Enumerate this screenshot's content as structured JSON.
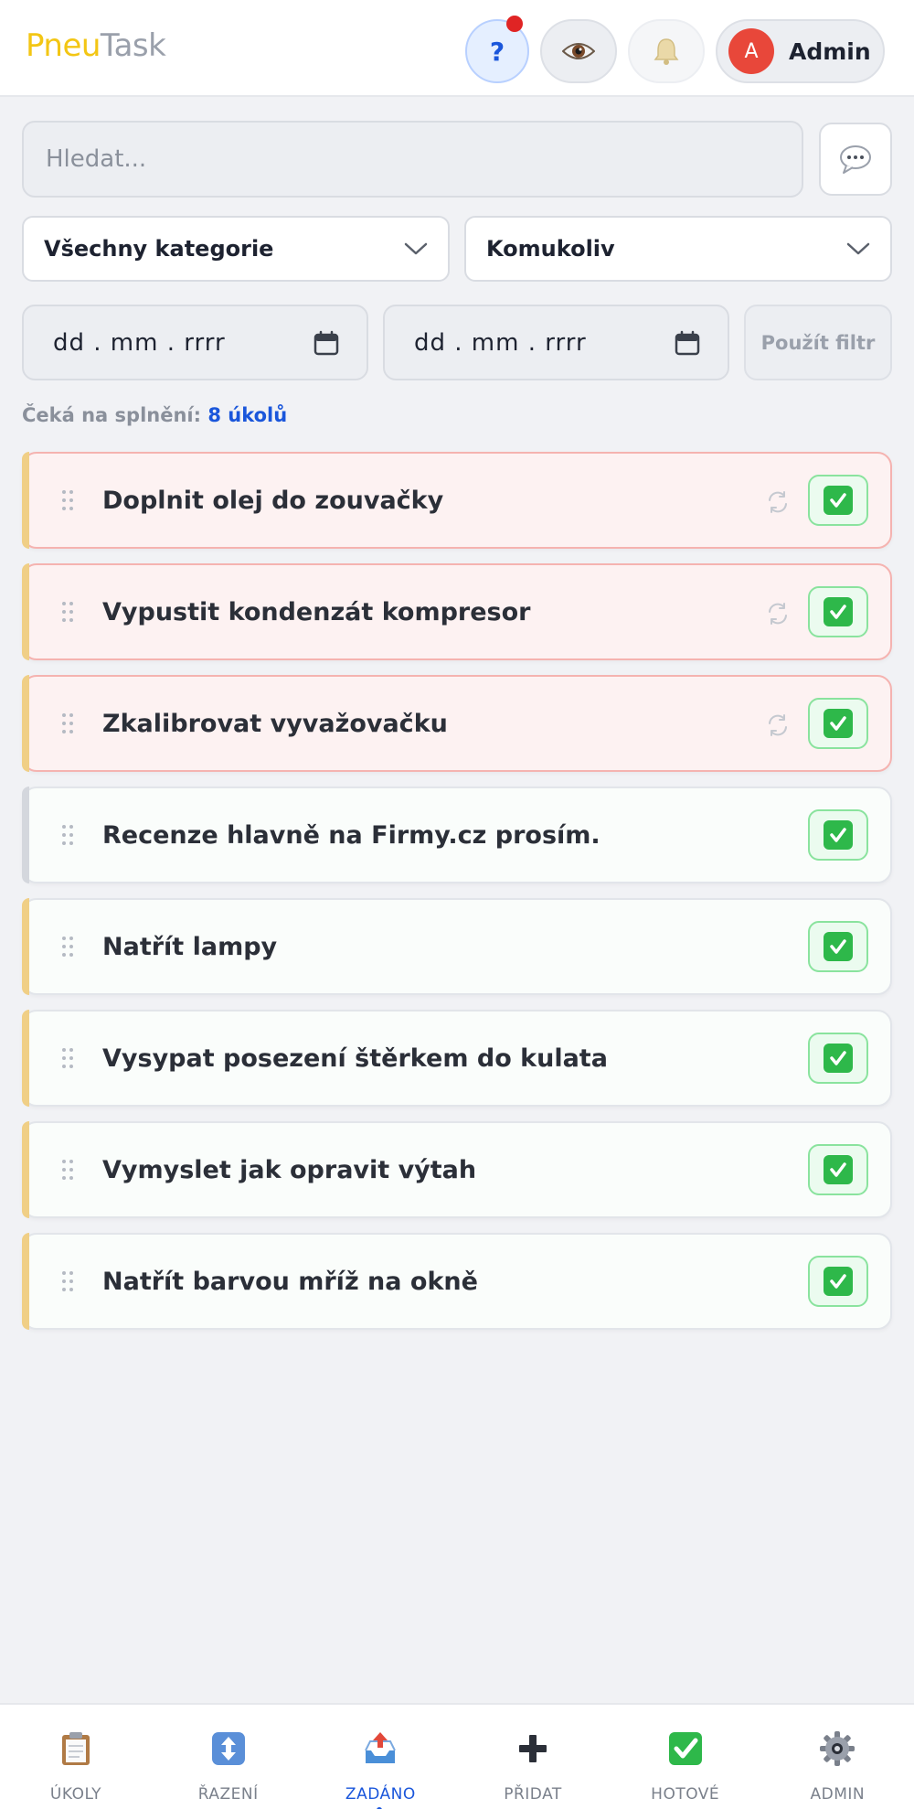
{
  "header": {
    "logo_part1": "Pneu",
    "logo_part2": "Task",
    "help_label": "?",
    "user": {
      "initial": "A",
      "name": "Admin"
    }
  },
  "search": {
    "placeholder": "Hledat..."
  },
  "filters": {
    "category": "Všechny kategorie",
    "assignee": "Komukoliv",
    "date_from_placeholder": "dd . mm . rrrr",
    "date_to_placeholder": "dd . mm . rrrr",
    "apply_label": "Použít filtr"
  },
  "counter": {
    "label": "Čeká na splnění:",
    "value": "8 úkolů"
  },
  "tasks": [
    {
      "title": "Doplnit olej do zouvačky",
      "overdue": true,
      "recurring": true,
      "accent": "#f0cf86"
    },
    {
      "title": "Vypustit kondenzát kompresor",
      "overdue": true,
      "recurring": true,
      "accent": "#f0cf86"
    },
    {
      "title": "Zkalibrovat vyvažovačku",
      "overdue": true,
      "recurring": true,
      "accent": "#f0cf86"
    },
    {
      "title": "Recenze hlavně na Firmy.cz prosím.",
      "overdue": false,
      "recurring": false,
      "accent": "#d4d7dd"
    },
    {
      "title": "Natřít lampy",
      "overdue": false,
      "recurring": false,
      "accent": "#f0cf86"
    },
    {
      "title": "Vysypat posezení štěrkem do kulata",
      "overdue": false,
      "recurring": false,
      "accent": "#f0cf86"
    },
    {
      "title": "Vymyslet jak opravit výtah",
      "overdue": false,
      "recurring": false,
      "accent": "#f0cf86"
    },
    {
      "title": "Natřít barvou mříž na okně",
      "overdue": false,
      "recurring": false,
      "accent": "#f0cf86"
    }
  ],
  "nav": [
    {
      "label": "ÚKOLY",
      "icon": "clipboard-icon",
      "active": false
    },
    {
      "label": "ŘAZENÍ",
      "icon": "sort-arrows-icon",
      "active": false
    },
    {
      "label": "ZADÁNO",
      "icon": "outbox-tray-icon",
      "active": true
    },
    {
      "label": "PŘIDAT",
      "icon": "plus-icon",
      "active": false
    },
    {
      "label": "HOTOVÉ",
      "icon": "check-mark-icon",
      "active": false
    },
    {
      "label": "ADMIN",
      "icon": "gear-icon",
      "active": false
    }
  ],
  "colors": {
    "accent_blue": "#1a56db",
    "logo_yellow": "#f3c614",
    "overdue_bg": "#fdf2f2",
    "done_green": "#2eb84a"
  }
}
